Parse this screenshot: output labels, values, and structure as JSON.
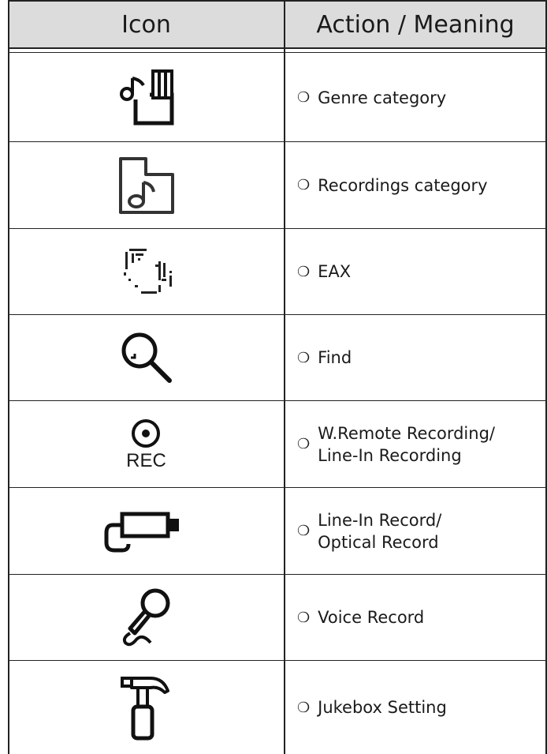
{
  "table": {
    "headers": {
      "icon": "Icon",
      "meaning": "Action / Meaning"
    },
    "bullet": "❍",
    "rows": [
      {
        "icon_name": "genre-category-icon",
        "meaning": "Genre category"
      },
      {
        "icon_name": "recordings-category-icon",
        "meaning": "Recordings category"
      },
      {
        "icon_name": "eax-icon",
        "meaning": "EAX"
      },
      {
        "icon_name": "find-magnifier-icon",
        "meaning": "Find"
      },
      {
        "icon_name": "rec-icon",
        "icon_text": "REC",
        "meaning": "W.Remote Recording/\nLine-In Recording"
      },
      {
        "icon_name": "line-in-cable-icon",
        "meaning": "Line-In Record/\nOptical Record"
      },
      {
        "icon_name": "microphone-icon",
        "meaning": "Voice Record"
      },
      {
        "icon_name": "hammer-icon",
        "meaning": "Jukebox Setting"
      }
    ]
  }
}
